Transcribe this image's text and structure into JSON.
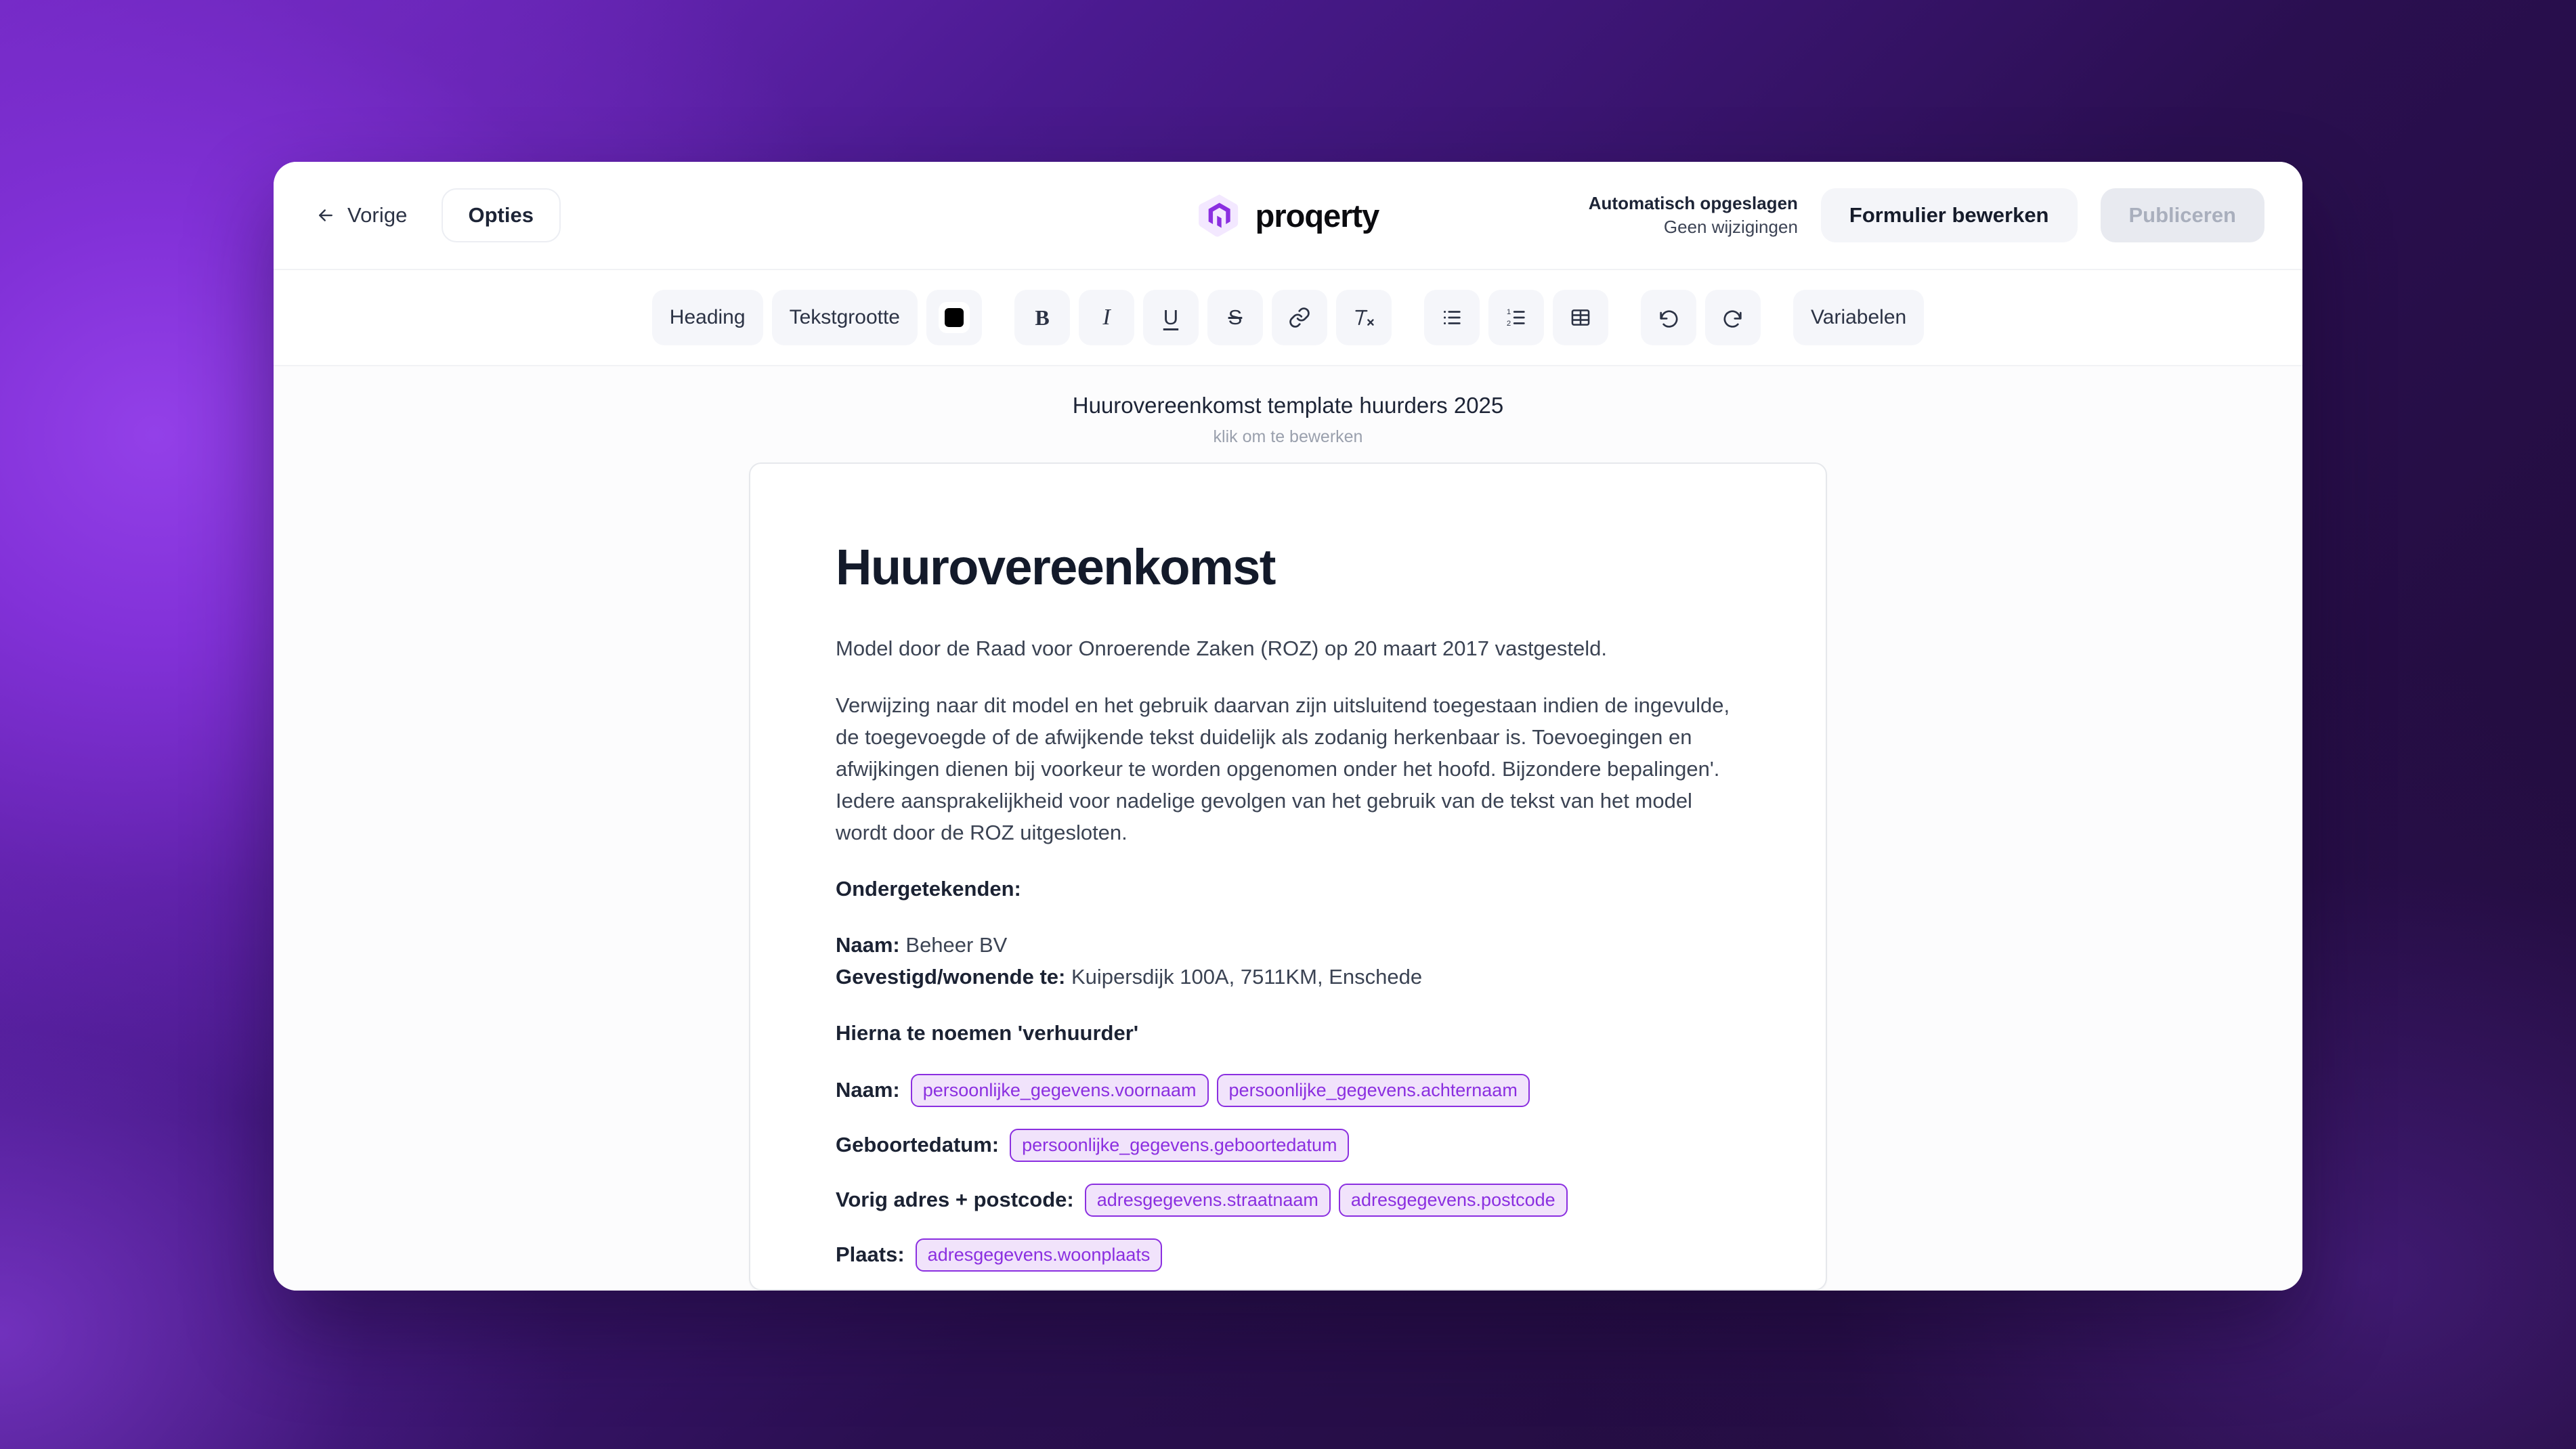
{
  "header": {
    "back_label": "Vorige",
    "options_label": "Opties",
    "brand_name": "proqerty",
    "brand_accent": "#8b2fe0",
    "autosave_title": "Automatisch opgeslagen",
    "autosave_subtitle": "Geen wijzigingen",
    "edit_form_label": "Formulier bewerken",
    "publish_label": "Publiceren"
  },
  "toolbar": {
    "heading_label": "Heading",
    "textsize_label": "Tekstgrootte",
    "text_color": "#000000",
    "bold_label": "B",
    "italic_label": "I",
    "underline_label": "U",
    "strike_label": "S",
    "variables_label": "Variabelen"
  },
  "document": {
    "title": "Huurovereenkomst template huurders 2025",
    "title_hint": "klik om te bewerken",
    "heading": "Huurovereenkomst",
    "intro": "Model door de Raad voor Onroerende Zaken (ROZ) op 20 maart 2017 vastgesteld.",
    "disclaimer": "Verwijzing naar dit model en het gebruik daarvan zijn uitsluitend toegestaan indien de ingevulde, de toegevoegde of de afwijkende tekst duidelijk als zodanig herkenbaar is. Toevoegingen en afwijkingen dienen bij voorkeur te worden opgenomen onder het hoofd. Bijzondere bepalingen'. Iedere aansprakelijkheid voor nadelige gevolgen van het gebruik van de tekst van het model wordt door de ROZ uitgesloten.",
    "undersigned_label": "Ondergetekenden:",
    "landlord": {
      "name_label": "Naam:",
      "name_value": "Beheer BV",
      "address_label": "Gevestigd/wonende te:",
      "address_value": "Kuipersdijk 100A, 7511KM, Enschede"
    },
    "landlord_note": "Hierna te noemen 'verhuurder'",
    "fields": [
      {
        "label": "Naam:",
        "chips": [
          "persoonlijke_gegevens.voornaam",
          "persoonlijke_gegevens.achternaam"
        ]
      },
      {
        "label": "Geboortedatum:",
        "chips": [
          "persoonlijke_gegevens.geboortedatum"
        ]
      },
      {
        "label": "Vorig adres + postcode:",
        "chips": [
          "adresgegevens.straatnaam",
          "adresgegevens.postcode"
        ]
      },
      {
        "label": "Plaats:",
        "chips": [
          "adresgegevens.woonplaats"
        ]
      }
    ]
  }
}
